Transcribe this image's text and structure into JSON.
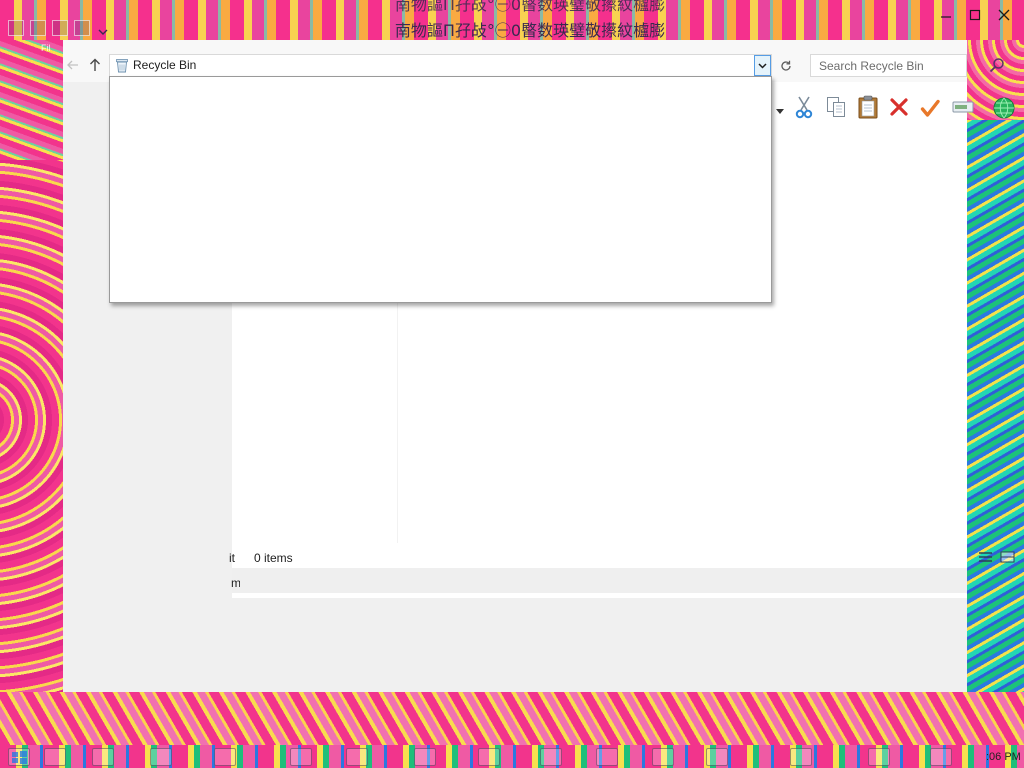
{
  "window": {
    "title": "南物謳П孖敁°㊀0暋数瑛璧敬攃紋櫨膨",
    "ribbon_fragment": "Fil",
    "controls": [
      "minimize-icon",
      "maximize-icon",
      "close-icon"
    ]
  },
  "navigation": {
    "back_icon": "back-arrow-icon",
    "up_icon": "up-arrow-icon",
    "refresh_icon": "refresh-icon"
  },
  "address_bar": {
    "icon": "recycle-bin-icon",
    "location": "Recycle Bin",
    "dropdown_open": true,
    "dropdown_items": []
  },
  "search": {
    "placeholder": "Search Recycle Bin",
    "value": "",
    "icon": "magnifier-icon"
  },
  "toolbar": {
    "items": [
      "scissors-icon",
      "copy-icon",
      "paste-icon",
      "delete-icon",
      "checkmark-icon",
      "rename-icon",
      "globe-icon"
    ]
  },
  "file_list": {
    "items": []
  },
  "status_bar": {
    "fragment_upper": "it",
    "item_count": "0 items",
    "fragment_lower": "m",
    "view_icons": [
      "details-view-icon",
      "large-icons-view-icon"
    ]
  },
  "taskbar": {
    "clock": ":06 PM"
  },
  "colors": {
    "window_bg": "#f0f0f0",
    "pane_bg": "#ffffff",
    "accent": "#569de5",
    "cut_blue": "#2f86d6",
    "delete_red": "#d8302c",
    "check_orange": "#e8782a",
    "backdrop_pink": "#f2348c",
    "backdrop_yellow": "#f8e04e",
    "backdrop_green": "#1cc37a"
  }
}
